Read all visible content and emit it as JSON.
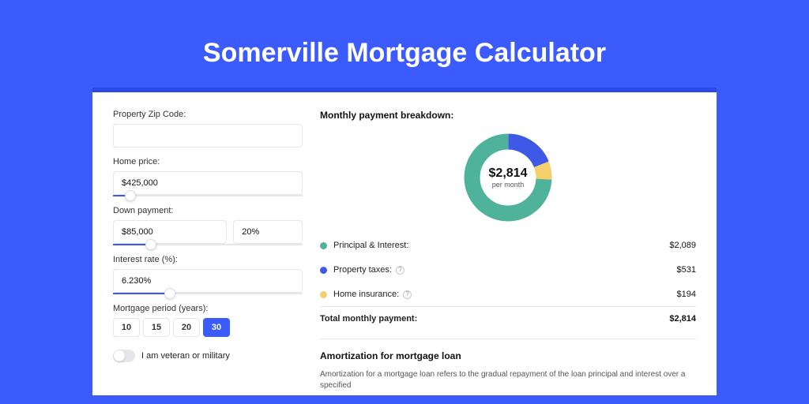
{
  "title": "Somerville Mortgage Calculator",
  "form": {
    "zip_label": "Property Zip Code:",
    "zip_value": "",
    "home_price_label": "Home price:",
    "home_price_value": "$425,000",
    "home_price_slider_pct": 9,
    "down_label": "Down payment:",
    "down_value": "$85,000",
    "down_pct": "20%",
    "down_slider_pct": 20,
    "rate_label": "Interest rate (%):",
    "rate_value": "6.230%",
    "rate_slider_pct": 30,
    "period_label": "Mortgage period (years):",
    "periods": [
      "10",
      "15",
      "20",
      "30"
    ],
    "period_selected": "30",
    "veteran_label": "I am veteran or military",
    "veteran_on": false
  },
  "breakdown": {
    "heading": "Monthly payment breakdown:",
    "center_value": "$2,814",
    "center_sub": "per month",
    "rows": [
      {
        "label": "Principal & Interest:",
        "value": "$2,089",
        "color": "#4fb29a",
        "info": false
      },
      {
        "label": "Property taxes:",
        "value": "$531",
        "color": "#3e59e5",
        "info": true
      },
      {
        "label": "Home insurance:",
        "value": "$194",
        "color": "#f4cf6b",
        "info": true
      }
    ],
    "total_label": "Total monthly payment:",
    "total_value": "$2,814"
  },
  "chart_data": {
    "type": "pie",
    "title": "Monthly payment breakdown",
    "slices": [
      {
        "name": "Principal & Interest",
        "value": 2089,
        "color": "#4fb29a"
      },
      {
        "name": "Property taxes",
        "value": 531,
        "color": "#3e59e5"
      },
      {
        "name": "Home insurance",
        "value": 194,
        "color": "#f4cf6b"
      }
    ],
    "total": 2814
  },
  "amort": {
    "heading": "Amortization for mortgage loan",
    "body": "Amortization for a mortgage loan refers to the gradual repayment of the loan principal and interest over a specified"
  }
}
